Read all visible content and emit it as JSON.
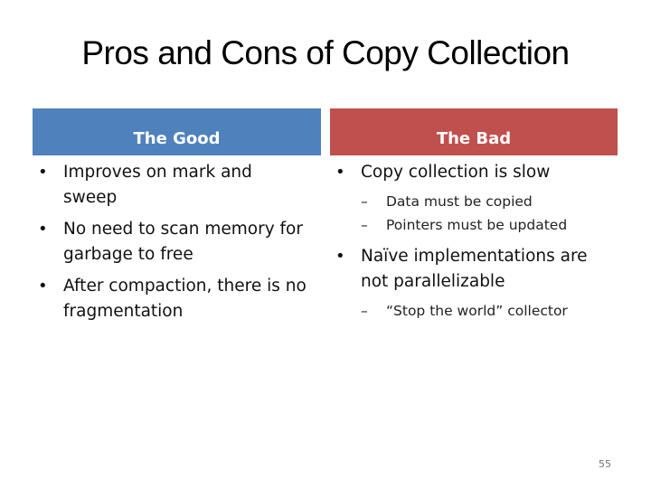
{
  "slide": {
    "title": "Pros and Cons of Copy Collection",
    "page_number": "55",
    "colors": {
      "good_header": "#4f81bd",
      "bad_header": "#c0504d"
    }
  },
  "good": {
    "header": "The Good",
    "bullets": [
      "Improves on mark and sweep",
      "No need to scan memory for garbage to free",
      "After compaction, there is no fragmentation"
    ]
  },
  "bad": {
    "header": "The Bad",
    "bullets": [
      {
        "text": "Copy collection is slow",
        "sub": [
          "Data must be copied",
          "Pointers must be updated"
        ]
      },
      {
        "text": "Naïve implementations are not parallelizable",
        "sub": [
          "“Stop the world” collector"
        ]
      }
    ],
    "bullet_symbol": "•",
    "dash_symbol": "–"
  }
}
